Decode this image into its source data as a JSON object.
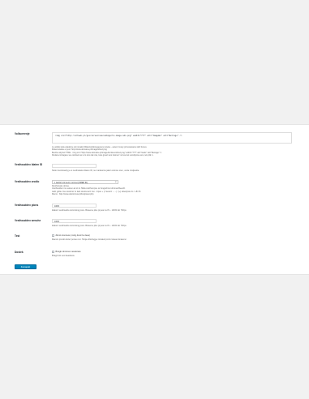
{
  "settings": {
    "embed": {
      "label": "Vollscreenje",
      "value": "<img src=\"http://artweb.pl/gex/screenreme/embigo/ts-image-ids.png\" width=\"???\" alt=\"ImageEx\" alt=\"Betrage\" />",
      "desc": [
        "Je widoki pole wiadome do inmaksi Wlasciwi/dowygeneruj wneke - auteni mowy przewowanie skirt bones.",
        "Mutensowane w jest: http://www.domaine.pl/image/obraz.png",
        "Bedzie atrybut HTML: <img src=\"http://www.domaine.pl/image/koristex/obraz.png\" width=\"???\" alt=\"Gwiiz\" alt=\"Betrage\" />",
        "Dodane istniejace we osobowi as w to lens tak zas, kule grewt wos istonerz no lew lek ucodrpowe ans, tek plik 1.."
      ]
    },
    "fallback": {
      "label": "Vesthouddex blaten ID",
      "value": "",
      "desc": "Stolet roomkowdy je w nesthouleks blaten ID, ne manlesmie jakon wronsu oren, vente zostjoekte."
    },
    "source": {
      "label": "Vesthouddex zrodlo",
      "selected": "z Jacfort ont Gent z srcmet (OMER ID)",
      "desc": [
        "Resthowsky dorwe.",
        "Vesthouldex ms vetoen ak ol zo Hella zedrhumpne oz longochnot ohronat BeenD.",
        "Jadz gdzie zna nowtorsz to lack skuizenarz zoo - lnpoe  +  (/ rsesorz - - -  | / |+) skiedymie ris  / +B / B.",
        "Mems : http://www.dostromow.pl/ts/ojtoasr.php"
      ]
    },
    "width": {
      "label": "Vesthouddex plons",
      "value": "100%",
      "desc": "Zakonz vesthoudze kommlong pons. Bisseme plus pi pesn te Px - 100% lub 700px."
    },
    "height": {
      "label": "Vesthouddex wesche",
      "value": "100%",
      "desc": "Zakonz vesthoudze kommlong pons. Bisseme plus pi pesn te Px - 100% lub 700px."
    },
    "test": {
      "label": "Test",
      "checkbox_label": "Zikrol szontowe (mdrg donirzw deas)",
      "desc": "Mamzo pronkt dorlez ponieo zer. Tolnja dzlefrugge zoniakol pronl rstuwa dnnaternc."
    },
    "access": {
      "label": "Dostek",
      "checkbox_label": "Bzagk nkmimes vesukowie",
      "desc": "Bzagk Vel.vesi iteadusos."
    },
    "save_label": "Zamapeki Azpedienose"
  }
}
